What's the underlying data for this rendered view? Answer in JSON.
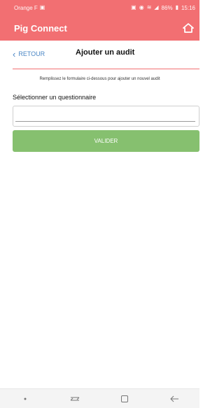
{
  "status_bar": {
    "carrier": "Orange F",
    "battery": "86%",
    "time": "15:16"
  },
  "app_bar": {
    "title": "Pig Connect",
    "home_icon": "home-icon"
  },
  "header": {
    "back_label": "RETOUR",
    "title": "Ajouter un audit"
  },
  "form": {
    "instructions": "Remplissez le formulaire ci-dessous pour ajouter un nouvel audit",
    "questionnaire_label": "Sélectionner un questionnaire",
    "questionnaire_value": "",
    "submit_label": "VALIDER"
  },
  "colors": {
    "accent": "#f26f72",
    "link": "#4a86c5",
    "button": "#86c06f"
  },
  "nav_bar": {
    "items": [
      "dot-icon",
      "recent-apps-icon",
      "home-square-icon",
      "back-arrow-icon"
    ]
  }
}
